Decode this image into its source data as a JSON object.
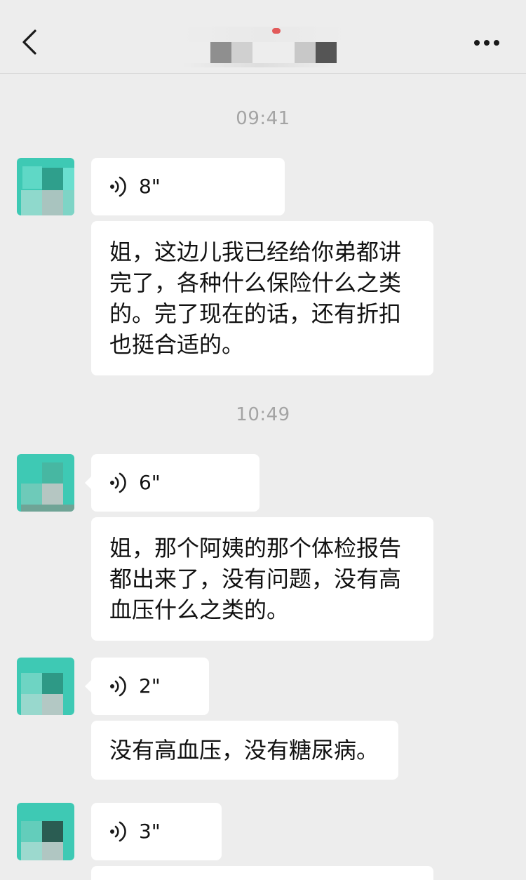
{
  "colors": {
    "background": "#ededed",
    "bubble": "#ffffff",
    "timestamp": "#a4a4a4",
    "avatar_teal": "#3ec9b4"
  },
  "header": {
    "back_icon": "chevron-left-icon",
    "more_icon": "ellipsis-icon"
  },
  "timestamps": [
    "09:41",
    "10:49"
  ],
  "messages": [
    {
      "voice_duration": "8\""
    },
    {
      "text_lines": [
        "姐，这边儿我已经给你弟都讲",
        "完了，各种什么保险什么之类",
        "的。完了现在的话，还有折扣",
        "也挺合适的。"
      ]
    },
    {
      "voice_duration": "6\""
    },
    {
      "text_lines": [
        "姐，那个阿姨的那个体检报告",
        "都出来了，没有问题，没有高",
        "血压什么之类的。"
      ]
    },
    {
      "voice_duration": "2\""
    },
    {
      "text_lines": [
        "没有高血压，没有糖尿病。"
      ]
    },
    {
      "voice_duration": "3\""
    }
  ]
}
